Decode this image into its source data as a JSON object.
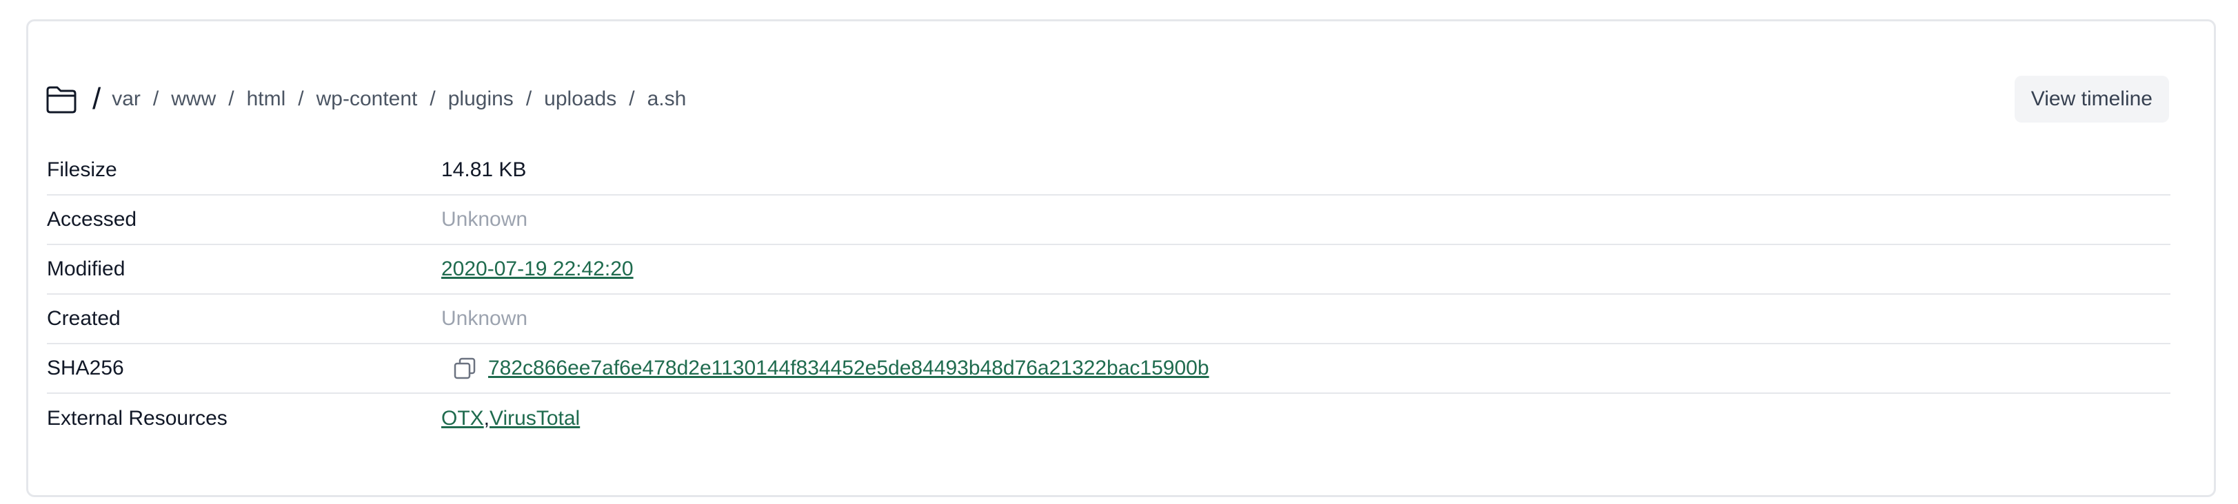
{
  "breadcrumb": {
    "root": "/",
    "parts": [
      "var",
      "www",
      "html",
      "wp-content",
      "plugins",
      "uploads",
      "a.sh"
    ],
    "separator": "/"
  },
  "header": {
    "timeline_button": "View timeline"
  },
  "details": {
    "filesize": {
      "label": "Filesize",
      "value": "14.81 KB"
    },
    "accessed": {
      "label": "Accessed",
      "value": "Unknown"
    },
    "modified": {
      "label": "Modified",
      "value": "2020-07-19 22:42:20"
    },
    "created": {
      "label": "Created",
      "value": "Unknown"
    },
    "sha256": {
      "label": "SHA256",
      "value": "782c866ee7af6e478d2e1130144f834452e5de84493b48d76a21322bac15900b"
    },
    "external": {
      "label": "External Resources",
      "links": [
        "OTX",
        "VirusTotal"
      ],
      "separator": ","
    }
  },
  "icons": {
    "folder": "folder-icon",
    "copy": "copy-icon"
  },
  "colors": {
    "link": "#1f6b4e",
    "muted": "#9ca3af",
    "border": "#e5e7eb",
    "button_bg": "#f3f4f6"
  }
}
